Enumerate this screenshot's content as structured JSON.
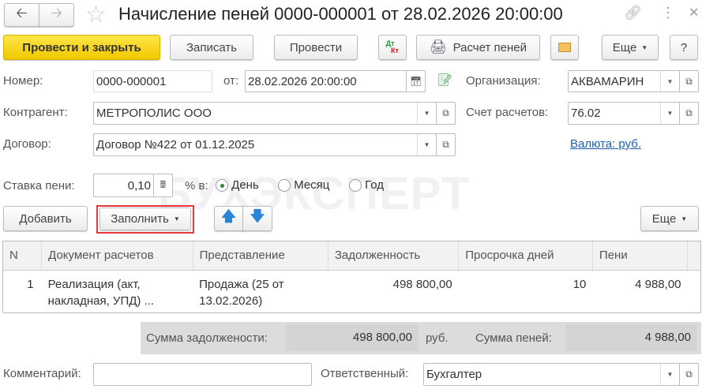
{
  "window": {
    "title": "Начисление пеней 0000-000001 от 28.02.2026 20:00:00"
  },
  "toolbar": {
    "post_close": "Провести и закрыть",
    "save": "Записать",
    "post": "Провести",
    "dtkt_dt": "Дт",
    "dtkt_kt": "Кт",
    "calc": "Расчет пеней",
    "more": "Еще",
    "help": "?"
  },
  "form": {
    "number_label": "Номер:",
    "number": "0000-000001",
    "date_label": "от:",
    "date": "28.02.2026 20:00:00",
    "org_label": "Организация:",
    "org": "АКВАМАРИН",
    "counterparty_label": "Контрагент:",
    "counterparty": "МЕТРОПОЛИС ООО",
    "account_label": "Счет расчетов:",
    "account": "76.02",
    "contract_label": "Договор:",
    "contract": "Договор №422 от 01.12.2025",
    "currency_link": "Валюта: руб.",
    "rate_label": "Ставка пени:",
    "rate": "0,10",
    "percent_label": "% в:",
    "periods": [
      {
        "label": "День",
        "selected": true
      },
      {
        "label": "Месяц",
        "selected": false
      },
      {
        "label": "Год",
        "selected": false
      }
    ]
  },
  "table_toolbar": {
    "add": "Добавить",
    "fill": "Заполнить",
    "more": "Еще"
  },
  "table": {
    "columns": [
      "N",
      "Документ расчетов",
      "Представление",
      "Задолженность",
      "Просрочка дней",
      "Пени"
    ],
    "rows": [
      {
        "n": "1",
        "doc": "Реализация (акт, накладная, УПД) ...",
        "repr": "Продажа (25 от 13.02.2026)",
        "debt": "498 800,00",
        "days": "10",
        "penalty": "4 988,00"
      }
    ]
  },
  "totals": {
    "debt_label": "Сумма задолжености:",
    "debt": "498 800,00",
    "currency": "руб.",
    "penalty_label": "Сумма пеней:",
    "penalty": "4 988,00"
  },
  "footer": {
    "comment_label": "Комментарий:",
    "comment": "",
    "responsible_label": "Ответственный:",
    "responsible": "Бухгалтер"
  },
  "watermark": "БУХЭКСПЕРТ"
}
